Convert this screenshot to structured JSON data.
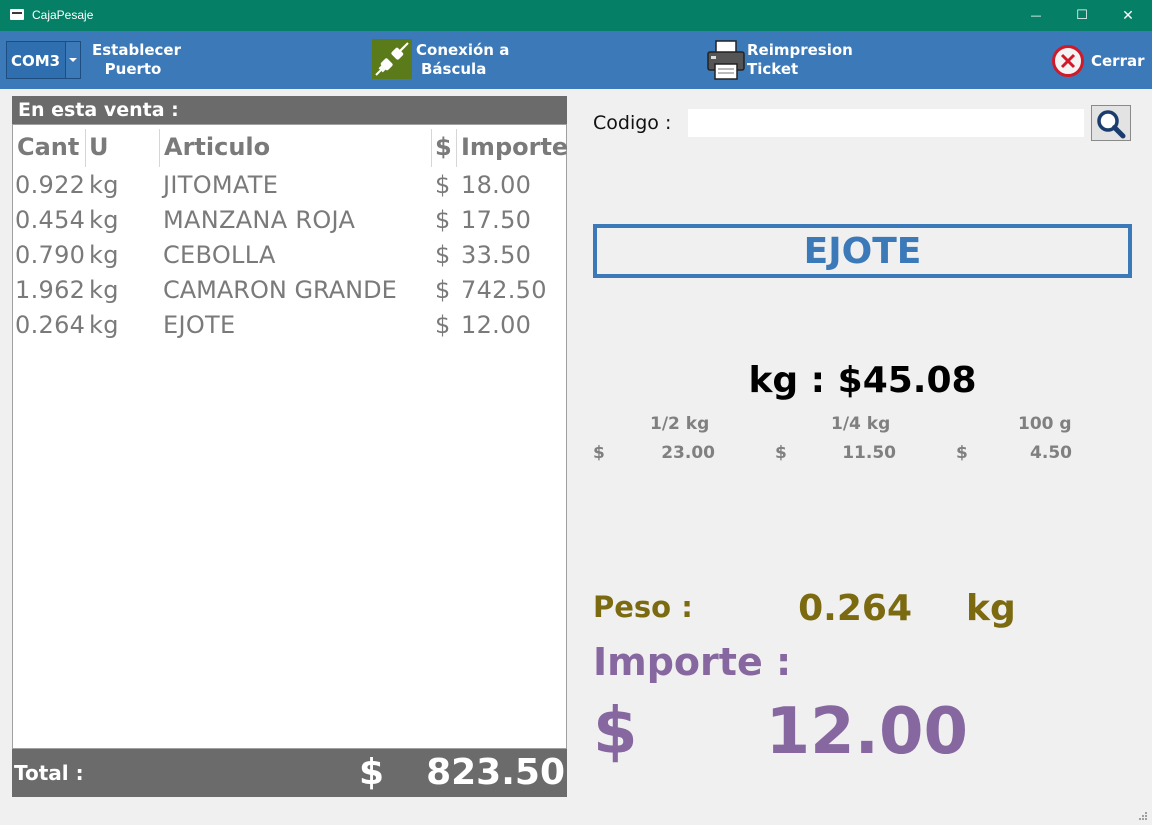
{
  "window": {
    "title": "CajaPesaje",
    "minimize_glyph": "—",
    "maximize_glyph": "☐",
    "close_glyph": "✕"
  },
  "toolbar": {
    "port_value": "COM3",
    "set_port_line1": "Establecer",
    "set_port_line2": "Puerto",
    "connect_line1": "Conexión a",
    "connect_line2": "Báscula",
    "reprint_line1": "Reimpresion",
    "reprint_line2": "Ticket",
    "close_label": "Cerrar"
  },
  "sale": {
    "header": "En esta venta :",
    "columns": {
      "qty": "Cant",
      "unit": "U",
      "item": "Articulo",
      "currency": "$",
      "amount": "Importe"
    },
    "rows": [
      {
        "qty": "0.922",
        "unit": "kg",
        "item": "JITOMATE",
        "currency": "$",
        "amount": "18.00"
      },
      {
        "qty": "0.454",
        "unit": "kg",
        "item": "MANZANA ROJA",
        "currency": "$",
        "amount": "17.50"
      },
      {
        "qty": "0.790",
        "unit": "kg",
        "item": "CEBOLLA",
        "currency": "$",
        "amount": "33.50"
      },
      {
        "qty": "1.962",
        "unit": "kg",
        "item": "CAMARON GRANDE",
        "currency": "$",
        "amount": "742.50"
      },
      {
        "qty": "0.264",
        "unit": "kg",
        "item": "EJOTE",
        "currency": "$",
        "amount": "12.00"
      }
    ],
    "total_label": "Total :",
    "total_currency": "$",
    "total_value": "823.50"
  },
  "detail": {
    "code_label": "Codigo :",
    "code_value": "",
    "product_name": "EJOTE",
    "price_prefix": "kg : ",
    "price_currency": "$",
    "price_value": "45.08",
    "fractions": [
      {
        "label": "1/2 kg",
        "currency": "$",
        "value": "23.00"
      },
      {
        "label": "1/4 kg",
        "currency": "$",
        "value": "11.50"
      },
      {
        "label": "100 g",
        "currency": "$",
        "value": "4.50"
      }
    ],
    "weight_label": "Peso :",
    "weight_value": "0.264",
    "weight_unit": "kg",
    "amount_label": "Importe :",
    "amount_currency": "$",
    "amount_value": "12.00"
  },
  "colors": {
    "titlebar": "#058066",
    "toolbar": "#3b79b9",
    "panel_header": "#6b6b6b",
    "weight": "#7b6a10",
    "amount": "#8767a0"
  }
}
